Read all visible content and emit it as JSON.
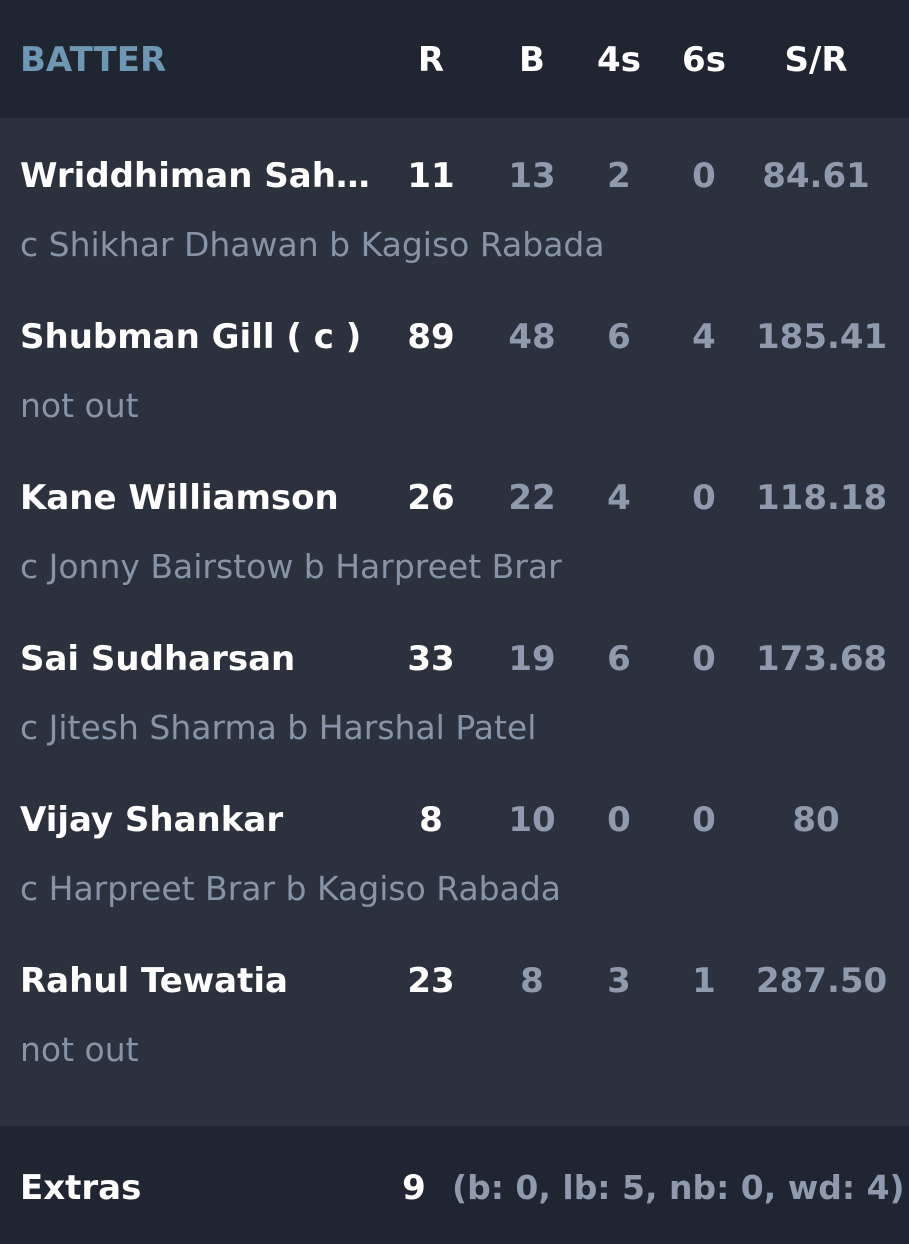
{
  "header": {
    "batter": "BATTER",
    "runs": "R",
    "balls": "B",
    "fours": "4s",
    "sixes": "6s",
    "strike_rate": "S/R"
  },
  "batters": [
    {
      "name": "Wriddhiman Saha…",
      "dismissal": "c Shikhar Dhawan b Kagiso Rabada",
      "r": "11",
      "b": "13",
      "fours": "2",
      "sixes": "0",
      "sr": "84.61"
    },
    {
      "name": "Shubman Gill ( c )",
      "dismissal": "not out",
      "r": "89",
      "b": "48",
      "fours": "6",
      "sixes": "4",
      "sr": "185.41"
    },
    {
      "name": "Kane Williamson",
      "dismissal": "c Jonny Bairstow b Harpreet Brar",
      "r": "26",
      "b": "22",
      "fours": "4",
      "sixes": "0",
      "sr": "118.18"
    },
    {
      "name": "Sai Sudharsan",
      "dismissal": "c Jitesh Sharma b Harshal Patel",
      "r": "33",
      "b": "19",
      "fours": "6",
      "sixes": "0",
      "sr": "173.68"
    },
    {
      "name": "Vijay Shankar",
      "dismissal": "c Harpreet Brar b Kagiso Rabada",
      "r": "8",
      "b": "10",
      "fours": "0",
      "sixes": "0",
      "sr": "80"
    },
    {
      "name": "Rahul Tewatia",
      "dismissal": "not out",
      "r": "23",
      "b": "8",
      "fours": "3",
      "sixes": "1",
      "sr": "287.50"
    }
  ],
  "extras": {
    "label": "Extras",
    "total": "9",
    "detail": "(b: 0, lb: 5, nb: 0, wd: 4)"
  }
}
